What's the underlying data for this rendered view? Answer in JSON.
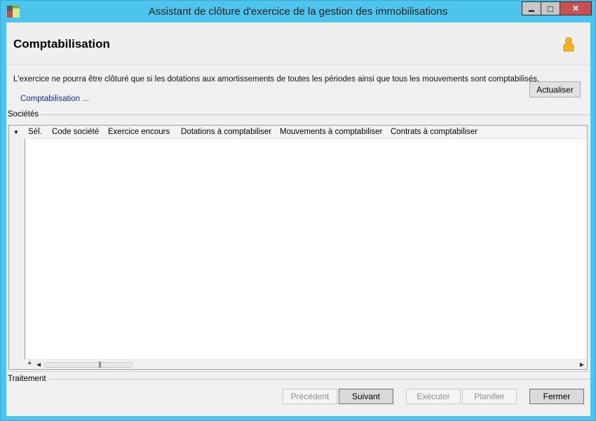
{
  "window": {
    "title": "Assistant de clôture d'exercice de la gestion des immobilisations",
    "minimize_glyph": "▁",
    "maximize_glyph": "□",
    "close_glyph": "✕"
  },
  "header": {
    "title": "Comptabilisation",
    "icon": "user-icon"
  },
  "description": "L'exercice ne pourra être clôturé que si les dotations aux amortissements de toutes les périodes ainsi que tous les mouvements sont comptabilisés.",
  "link_label": "Comptabilisation ...",
  "refresh_button": "Actualiser",
  "companies_group": {
    "label": "Sociétés",
    "columns": [
      "Sél.",
      "Code société",
      "Exercice encours",
      "Dotations à comptabiliser",
      "Mouvements à comptabiliser",
      "Contrats à comptabiliser"
    ],
    "rows": [],
    "row_menu_glyph": "▼",
    "add_glyph": "+",
    "scroll_left_glyph": "◀",
    "scroll_right_glyph": "▶",
    "thumb_grip": "|||"
  },
  "processing_group": {
    "label": "Traitement"
  },
  "buttons": {
    "previous": "Précédent",
    "next": "Suivant",
    "execute": "Exécuter",
    "schedule": "Planifier",
    "close": "Fermer"
  }
}
